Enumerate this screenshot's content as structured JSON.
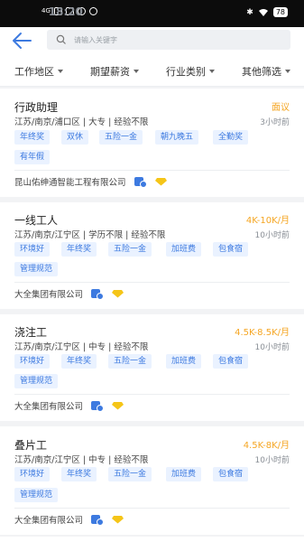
{
  "status": {
    "network": "4G",
    "time": "18:20",
    "battery": "78"
  },
  "search": {
    "placeholder": "请输入关键字"
  },
  "filters": [
    {
      "label": "工作地区"
    },
    {
      "label": "期望薪资"
    },
    {
      "label": "行业类别"
    },
    {
      "label": "其他筛选"
    }
  ],
  "jobs": [
    {
      "title": "行政助理",
      "salary": "面议",
      "meta": "江苏/南京/浦口区 | 大专 | 经验不限",
      "time": "3小时前",
      "tags": [
        "年终奖",
        "双休",
        "五险一金",
        "朝九晚五",
        "全勤奖",
        "有年假"
      ],
      "company": "昆山佑绅通智能工程有限公司"
    },
    {
      "title": "一线工人",
      "salary": "4K-10K/月",
      "meta": "江苏/南京/江宁区 | 学历不限 | 经验不限",
      "time": "10小时前",
      "tags": [
        "环境好",
        "年终奖",
        "五险一金",
        "加班费",
        "包食宿",
        "管理规范"
      ],
      "company": "大全集团有限公司"
    },
    {
      "title": "浇注工",
      "salary": "4.5K-8.5K/月",
      "meta": "江苏/南京/江宁区 | 中专 | 经验不限",
      "time": "10小时前",
      "tags": [
        "环境好",
        "年终奖",
        "五险一金",
        "加班费",
        "包食宿",
        "管理规范"
      ],
      "company": "大全集团有限公司"
    },
    {
      "title": "叠片工",
      "salary": "4.5K-8K/月",
      "meta": "江苏/南京/江宁区 | 中专 | 经验不限",
      "time": "10小时前",
      "tags": [
        "环境好",
        "年终奖",
        "五险一金",
        "加班费",
        "包食宿",
        "管理规范"
      ],
      "company": "大全集团有限公司"
    }
  ],
  "colors": {
    "accent": "#3d7ae0",
    "salary": "#f5a623",
    "tag_bg": "#eaf2ff"
  },
  "icons": {
    "back": "arrow-left-icon",
    "search": "search-icon",
    "company_verified": "verified-company-icon",
    "company_vip": "diamond-icon"
  }
}
